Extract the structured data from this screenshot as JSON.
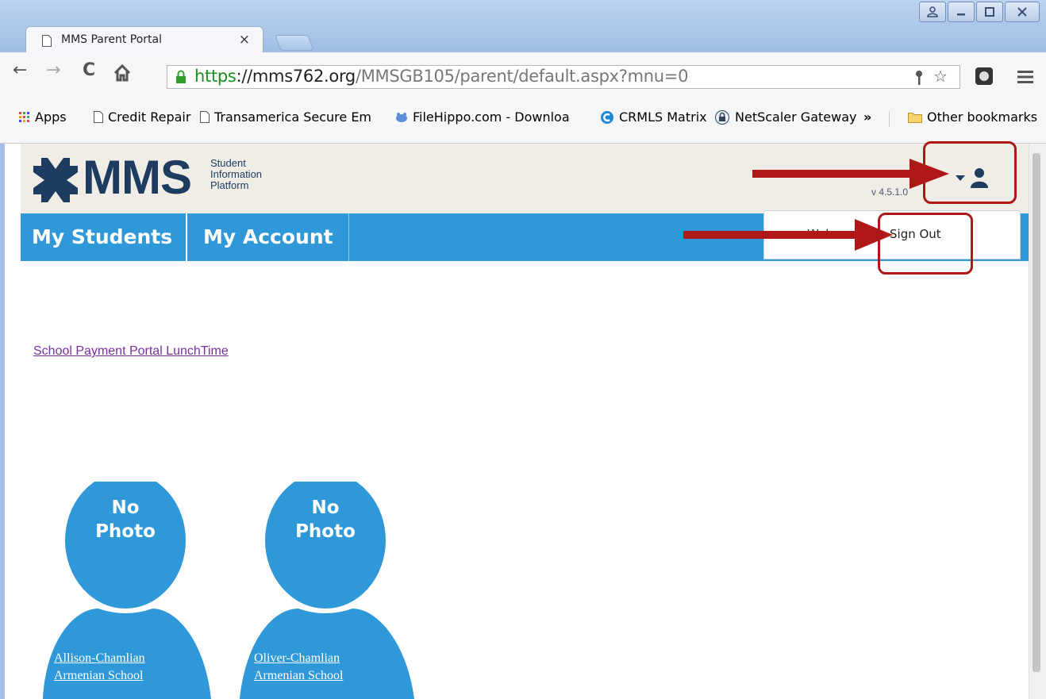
{
  "browser": {
    "tab_title": "MMS Parent Portal",
    "tab_close": "×",
    "url_scheme": "https",
    "url_host": "://mms762.org",
    "url_path": "/MMSGB105/parent/default.aspx?mnu=0",
    "window_controls": [
      "user-icon",
      "minimize-icon",
      "maximize-icon",
      "close-icon"
    ],
    "bookmarks": [
      {
        "label": "Apps",
        "icon": "apps-grid-icon"
      },
      {
        "label": "Credit Repair",
        "icon": "page-icon"
      },
      {
        "label": "Transamerica Secure Em",
        "icon": "page-icon"
      },
      {
        "label": "FileHippo.com - Downloa",
        "icon": "filehippo-icon"
      },
      {
        "label": "CRMLS Matrix",
        "icon": "crmls-icon"
      },
      {
        "label": "NetScaler Gateway",
        "icon": "netscaler-icon"
      }
    ],
    "bookmarks_more": "»",
    "other_bookmarks": "Other bookmarks"
  },
  "header": {
    "logo_text": "MMS",
    "logo_sub": [
      "Student",
      "Information",
      "Platform"
    ],
    "version": "v 4.5.1.0"
  },
  "nav": {
    "items": [
      "My Students",
      "My Account"
    ]
  },
  "user_dropdown": {
    "welcome": "Welcome",
    "sign_out": "Sign Out"
  },
  "links": {
    "portal": "School Payment Portal LunchTime"
  },
  "students": [
    {
      "photo": "No Photo",
      "name_line1": "Allison-Chamlian",
      "name_line2": "Armenian School"
    },
    {
      "photo": "No Photo",
      "name_line1": "Oliver-Chamlian",
      "name_line2": "Armenian School"
    }
  ],
  "colors": {
    "nav_blue": "#2f98d8",
    "header_bg": "#f0ede7",
    "logo_navy": "#1d3c60",
    "annotation_red": "#b01818"
  }
}
